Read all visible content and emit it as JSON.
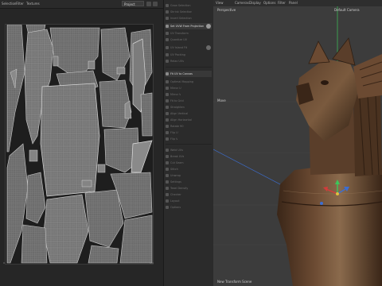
{
  "uv_editor": {
    "menu": [
      "Selection",
      "Filter",
      "Textures"
    ],
    "project_select": "Project",
    "axis_zero": "0",
    "axis_one": "1,0"
  },
  "tools": {
    "items": [
      {
        "label": "Grow Selection",
        "active": false
      },
      {
        "label": "Shrink Selection",
        "active": false
      },
      {
        "label": "Invert Selection",
        "active": false
      },
      {
        "label": "Set UVW From Projection",
        "active": true
      },
      {
        "label": "UV Transform",
        "active": false
      },
      {
        "label": "Quantize UV",
        "active": false
      },
      {
        "label": "UV Island Fit",
        "active": false
      },
      {
        "label": "UV Packing",
        "active": false
      },
      {
        "label": "Relax UVs",
        "active": false
      },
      {
        "label": "Fit UV to Canvas",
        "active": true
      },
      {
        "label": "Optimal Mapping",
        "active": false
      },
      {
        "label": "Mirror U",
        "active": false
      },
      {
        "label": "Mirror V",
        "active": false
      },
      {
        "label": "Fit to Grid",
        "active": false
      },
      {
        "label": "Straighten",
        "active": false
      },
      {
        "label": "Align Vertical",
        "active": false
      },
      {
        "label": "Align Horizontal",
        "active": false
      },
      {
        "label": "Rotate 90",
        "active": false
      },
      {
        "label": "Flip U",
        "active": false
      },
      {
        "label": "Flip V",
        "active": false
      },
      {
        "label": "Weld UVs",
        "active": false
      },
      {
        "label": "Break UVs",
        "active": false
      },
      {
        "label": "Cut Seam",
        "active": false
      },
      {
        "label": "Stitch",
        "active": false
      },
      {
        "label": "Unwrap",
        "active": false
      },
      {
        "label": "Settings",
        "active": false
      },
      {
        "label": "Texel Density",
        "active": false
      },
      {
        "label": "Checker",
        "active": false
      },
      {
        "label": "Layout",
        "active": false
      },
      {
        "label": "Options",
        "active": false
      }
    ]
  },
  "viewport": {
    "menu": [
      "View",
      "Cameras",
      "Display",
      "Options",
      "Filter",
      "Panel"
    ],
    "perspective_label": "Perspective",
    "camera_label": "Default Camera",
    "move_label": "Move",
    "status": "New Transform Scene"
  },
  "colors": {
    "accent": "#3a8fd6",
    "axis_x": "#d23c3c",
    "axis_y": "#3cc85a",
    "axis_z": "#3c6ed2",
    "wood_dark": "#3a2618",
    "wood_mid": "#6b4a32",
    "wood_light": "#8a6a4c"
  }
}
